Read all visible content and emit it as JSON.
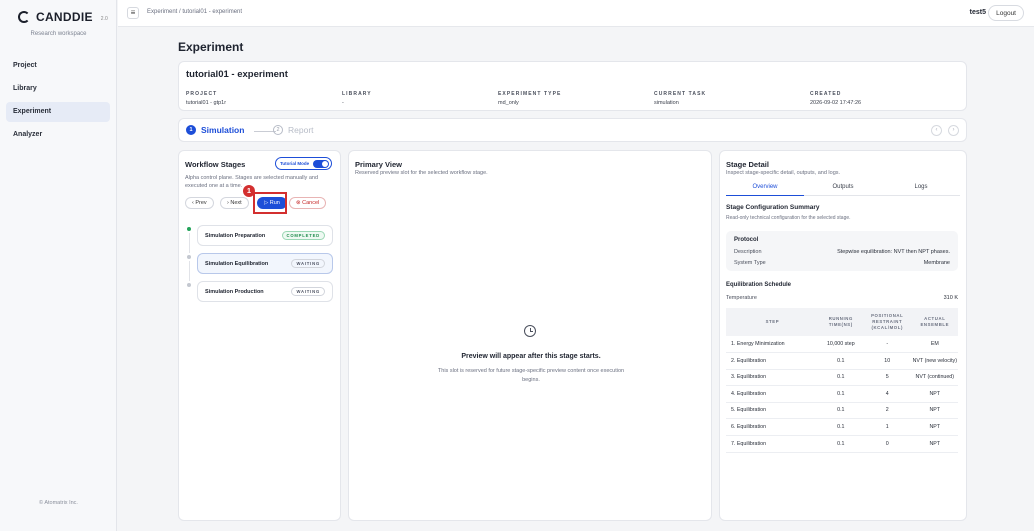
{
  "app": {
    "name": "CANDDIE",
    "version": "2.0",
    "workspace": "Research workspace",
    "copyright": "© Atomatrix Inc."
  },
  "nav": {
    "items": [
      {
        "label": "Project"
      },
      {
        "label": "Library"
      },
      {
        "label": "Experiment",
        "active": true
      },
      {
        "label": "Analyzer"
      }
    ]
  },
  "topbar": {
    "menu_icon": "menu-icon",
    "breadcrumb": "Experiment / tutorial01 - experiment",
    "user": "test5",
    "logout_label": "Logout"
  },
  "page": {
    "title": "Experiment"
  },
  "experiment": {
    "name": "tutorial01 - experiment",
    "meta": [
      {
        "label": "PROJECT",
        "value": "tutorial01 - gtp1r"
      },
      {
        "label": "LIBRARY",
        "value": "-"
      },
      {
        "label": "EXPERIMENT TYPE",
        "value": "md_only"
      },
      {
        "label": "CURRENT TASK",
        "value": "simulation"
      },
      {
        "label": "CREATED",
        "value": "2026-09-02 17:47:26"
      }
    ]
  },
  "stepper": {
    "steps": [
      {
        "num": "1",
        "label": "Simulation",
        "active": true
      },
      {
        "num": "2",
        "label": "Report",
        "active": false
      }
    ],
    "prev_icon": "chevron-left-icon",
    "next_icon": "chevron-right-icon"
  },
  "workflow": {
    "title": "Workflow Stages",
    "tutorial_label": "Tutorial Mode",
    "tutorial_on": true,
    "description": "Alpha control plane. Stages are selected manually and executed one at a time.",
    "buttons": {
      "prev": "‹ Prev",
      "next": "› Next",
      "run": "▷ Run",
      "cancel": "⊗ Cancel"
    },
    "annotation_number": "1",
    "stages": [
      {
        "name": "Simulation Preparation",
        "status": "COMPLETED"
      },
      {
        "name": "Simulation Equilibration",
        "status": "WAITING"
      },
      {
        "name": "Simulation Production",
        "status": "WAITING"
      }
    ]
  },
  "preview": {
    "title": "Primary View",
    "subtitle": "Reserved preview slot for the selected workflow stage.",
    "empty_title": "Preview will appear after this stage starts.",
    "empty_desc": "This slot is reserved for future stage-specific preview content once execution begins."
  },
  "stage_detail": {
    "title": "Stage Detail",
    "subtitle": "Inspect stage-specific detail, outputs, and logs.",
    "tabs": [
      {
        "label": "Overview",
        "active": true
      },
      {
        "label": "Outputs"
      },
      {
        "label": "Logs"
      }
    ],
    "config_title": "Stage Configuration Summary",
    "config_sub": "Read-only technical configuration for the selected stage.",
    "protocol": {
      "title": "Protocol",
      "rows": [
        {
          "key": "Description",
          "value": "Stepwise equilibration: NVT then NPT phases."
        },
        {
          "key": "System Type",
          "value": "Membrane"
        }
      ]
    },
    "schedule_title": "Equilibration Schedule",
    "temperature": {
      "key": "Temperature",
      "value": "310 K"
    },
    "table": {
      "headers": [
        "STEP",
        "RUNNING TIME(NS)",
        "POSITIONAL RESTRAINT (KCAL/MOL)",
        "ACTUAL ENSEMBLE"
      ],
      "rows": [
        [
          "1. Energy Minimization",
          "10,000 step",
          "-",
          "EM"
        ],
        [
          "2. Equilibration",
          "0.1",
          "10",
          "NVT (new velocity)"
        ],
        [
          "3. Equilibration",
          "0.1",
          "5",
          "NVT (continued)"
        ],
        [
          "4. Equilibration",
          "0.1",
          "4",
          "NPT"
        ],
        [
          "5. Equilibration",
          "0.1",
          "2",
          "NPT"
        ],
        [
          "6. Equilibration",
          "0.1",
          "1",
          "NPT"
        ],
        [
          "7. Equilibration",
          "0.1",
          "0",
          "NPT"
        ]
      ]
    }
  }
}
